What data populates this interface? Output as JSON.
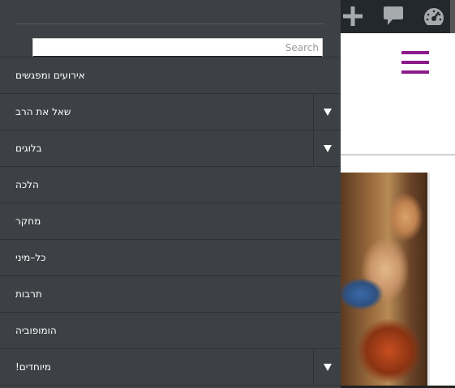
{
  "search": {
    "placeholder": "Search",
    "value": ""
  },
  "menu": [
    {
      "label": "אירועים ומפגשים",
      "has_children": false
    },
    {
      "label": "שאל את הרב",
      "has_children": true
    },
    {
      "label": "בלוגים",
      "has_children": true
    },
    {
      "label": "הלכה",
      "has_children": false
    },
    {
      "label": "מחקר",
      "has_children": false
    },
    {
      "label": "כל–מיני",
      "has_children": false
    },
    {
      "label": "תרבות",
      "has_children": false
    },
    {
      "label": "הומופוביה",
      "has_children": false
    },
    {
      "label": "מיוחדים!",
      "has_children": true
    }
  ],
  "icons": {
    "toggle": "caret-down-icon",
    "adminbar": [
      "plus-icon",
      "comment-icon",
      "dashboard-icon"
    ],
    "hamburger": "hamburger-menu-icon"
  },
  "colors": {
    "drawer_bg": "#3d4145",
    "adminbar_bg": "#23282d",
    "accent": "#8b1a8b",
    "text": "#ffffff"
  }
}
